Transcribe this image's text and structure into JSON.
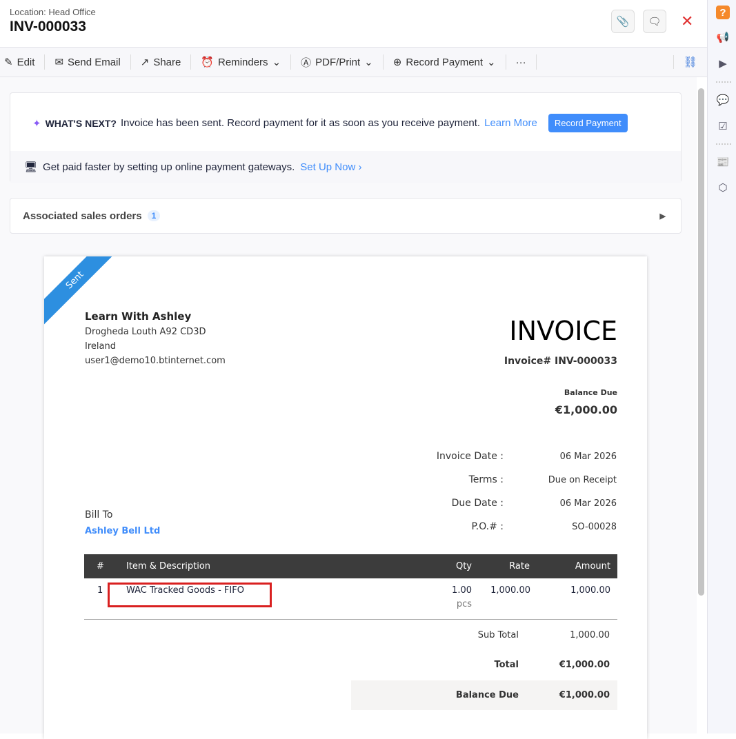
{
  "header": {
    "location": "Location: Head Office",
    "title": "INV-000033"
  },
  "toolbar": {
    "edit": "Edit",
    "send_email": "Send Email",
    "share": "Share",
    "reminders": "Reminders",
    "pdf_print": "PDF/Print",
    "record_payment": "Record Payment",
    "more": "···"
  },
  "whats_next": {
    "label": "WHAT'S NEXT?",
    "text": "Invoice has been sent. Record payment for it as soon as you receive payment.",
    "learn_more": "Learn More",
    "button": "Record Payment",
    "gateway_text": "Get paid faster by setting up online payment gateways.",
    "setup": "Set Up Now ›"
  },
  "associated": {
    "label": "Associated sales orders",
    "count": "1"
  },
  "invoice": {
    "status": "Sent",
    "org": "Learn With Ashley",
    "addr1": "Drogheda Louth A92 CD3D",
    "addr2": "Ireland",
    "email": "user1@demo10.btinternet.com",
    "heading": "INVOICE",
    "number": "Invoice# INV-000033",
    "balance_label": "Balance Due",
    "balance": "€1,000.00",
    "meta": [
      {
        "k": "Invoice Date :",
        "v": "06 Mar 2026"
      },
      {
        "k": "Terms :",
        "v": "Due on Receipt"
      },
      {
        "k": "Due Date :",
        "v": "06 Mar 2026"
      },
      {
        "k": "P.O.# :",
        "v": "SO-00028"
      }
    ],
    "bill_to": "Bill To",
    "customer": "Ashley Bell Ltd",
    "columns": [
      "#",
      "Item & Description",
      "Qty",
      "Rate",
      "Amount"
    ],
    "rows": [
      {
        "n": "1",
        "item": "WAC Tracked Goods - FIFO",
        "qty": "1.00",
        "unit": "pcs",
        "rate": "1,000.00",
        "amount": "1,000.00"
      }
    ],
    "subtotal_label": "Sub Total",
    "subtotal": "1,000.00",
    "total_label": "Total",
    "total": "€1,000.00",
    "bd_label": "Balance Due",
    "bd": "€1,000.00"
  }
}
